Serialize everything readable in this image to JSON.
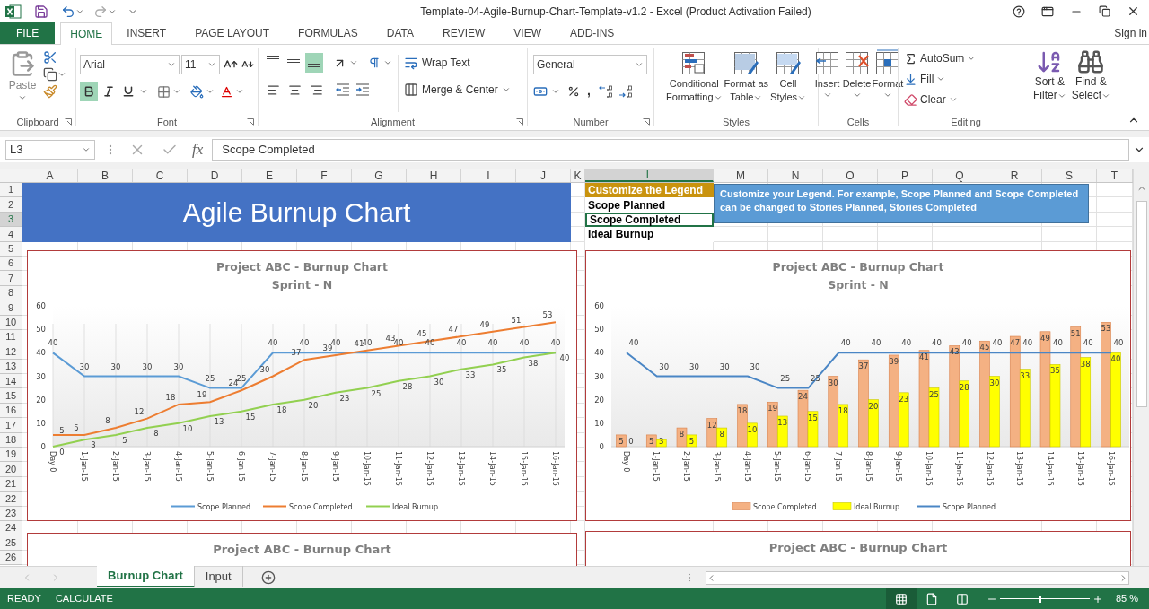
{
  "title_bar": {
    "title": "Template-04-Agile-Burnup-Chart-Template-v1.2 - Excel (Product Activation Failed)"
  },
  "ribbon_tabs": [
    {
      "label": "FILE",
      "kind": "file",
      "selected": false
    },
    {
      "label": "HOME",
      "kind": "tab",
      "selected": true
    },
    {
      "label": "INSERT",
      "kind": "tab",
      "selected": false
    },
    {
      "label": "PAGE LAYOUT",
      "kind": "tab",
      "selected": false
    },
    {
      "label": "FORMULAS",
      "kind": "tab",
      "selected": false
    },
    {
      "label": "DATA",
      "kind": "tab",
      "selected": false
    },
    {
      "label": "REVIEW",
      "kind": "tab",
      "selected": false
    },
    {
      "label": "VIEW",
      "kind": "tab",
      "selected": false
    },
    {
      "label": "ADD-INS",
      "kind": "tab",
      "selected": false
    }
  ],
  "sign_in": "Sign in",
  "ribbon": {
    "clipboard": {
      "label": "Clipboard",
      "paste": "Paste"
    },
    "font": {
      "label": "Font",
      "font_name": "Arial",
      "font_size": "11",
      "toggles": [
        {
          "kind": "bold",
          "selected": true
        },
        {
          "kind": "italic",
          "selected": false
        },
        {
          "kind": "underline",
          "selected": false
        }
      ]
    },
    "alignment": {
      "label": "Alignment",
      "vertical": [
        {
          "kind": "top",
          "selected": false
        },
        {
          "kind": "middle",
          "selected": false
        },
        {
          "kind": "bottom",
          "selected": true
        }
      ],
      "horizontal": [
        {
          "kind": "left",
          "selected": false
        },
        {
          "kind": "center",
          "selected": false
        },
        {
          "kind": "right",
          "selected": false
        }
      ],
      "wrap_text": "Wrap Text",
      "merge_center": "Merge & Center"
    },
    "number": {
      "label": "Number",
      "format": "General",
      "comma": ","
    },
    "styles": {
      "label": "Styles",
      "buttons": [
        {
          "kind": "conditional",
          "line1": "Conditional",
          "line2": "Formatting"
        },
        {
          "kind": "table",
          "line1": "Format as",
          "line2": "Table"
        },
        {
          "kind": "cell_styles",
          "line1": "Cell",
          "line2": "Styles"
        }
      ]
    },
    "cells": {
      "label": "Cells",
      "buttons": [
        {
          "kind": "insert",
          "label": "Insert"
        },
        {
          "kind": "delete",
          "label": "Delete"
        },
        {
          "kind": "format",
          "label": "Format"
        }
      ]
    },
    "editing": {
      "label": "Editing",
      "autosum": "AutoSum",
      "fill": "Fill",
      "clear": "Clear",
      "sort": [
        "Sort &",
        "Filter"
      ],
      "find": [
        "Find &",
        "Select"
      ]
    }
  },
  "formula_bar": {
    "name_box": "L3",
    "fx": "fx",
    "value": "Scope Completed"
  },
  "sheet": {
    "columns": [
      {
        "label": "A",
        "selected": false
      },
      {
        "label": "B",
        "selected": false
      },
      {
        "label": "C",
        "selected": false
      },
      {
        "label": "D",
        "selected": false
      },
      {
        "label": "E",
        "selected": false
      },
      {
        "label": "F",
        "selected": false
      },
      {
        "label": "G",
        "selected": false
      },
      {
        "label": "H",
        "selected": false
      },
      {
        "label": "I",
        "selected": false
      },
      {
        "label": "J",
        "selected": false
      },
      {
        "label": "K",
        "selected": false
      },
      {
        "label": "L",
        "selected": true
      },
      {
        "label": "M",
        "selected": false
      },
      {
        "label": "N",
        "selected": false
      },
      {
        "label": "O",
        "selected": false
      },
      {
        "label": "P",
        "selected": false
      },
      {
        "label": "Q",
        "selected": false
      },
      {
        "label": "R",
        "selected": false
      },
      {
        "label": "S",
        "selected": false
      },
      {
        "label": "T",
        "selected": false
      }
    ],
    "rows": [
      {
        "label": "1",
        "selected": false
      },
      {
        "label": "2",
        "selected": false
      },
      {
        "label": "3",
        "selected": true
      },
      {
        "label": "4",
        "selected": false
      },
      {
        "label": "5",
        "selected": false
      },
      {
        "label": "6",
        "selected": false
      },
      {
        "label": "7",
        "selected": false
      },
      {
        "label": "8",
        "selected": false
      },
      {
        "label": "9",
        "selected": false
      },
      {
        "label": "10",
        "selected": false
      },
      {
        "label": "11",
        "selected": false
      },
      {
        "label": "12",
        "selected": false
      },
      {
        "label": "13",
        "selected": false
      },
      {
        "label": "14",
        "selected": false
      },
      {
        "label": "15",
        "selected": false
      },
      {
        "label": "16",
        "selected": false
      },
      {
        "label": "17",
        "selected": false
      },
      {
        "label": "18",
        "selected": false
      },
      {
        "label": "19",
        "selected": false
      },
      {
        "label": "20",
        "selected": false
      },
      {
        "label": "21",
        "selected": false
      },
      {
        "label": "22",
        "selected": false
      },
      {
        "label": "23",
        "selected": false
      },
      {
        "label": "24",
        "selected": false
      },
      {
        "label": "25",
        "selected": false
      },
      {
        "label": "26",
        "selected": false
      }
    ],
    "banner": "Agile Burnup Chart",
    "legend_cells": [
      {
        "text": "Customize the Legend",
        "kind": "header",
        "selected": false
      },
      {
        "text": "Scope Planned",
        "kind": "plain",
        "selected": false
      },
      {
        "text": "Scope Completed",
        "kind": "plain",
        "selected": true
      },
      {
        "text": "Ideal Burnup",
        "kind": "plain",
        "selected": false
      }
    ],
    "note": "Customize your Legend. For example,  Scope Planned and Scope Completed can be changed to Stories Planned, Stories Completed",
    "charts": [
      {
        "title": "Project ABC - Burnup Chart",
        "subtitle": "Sprint - N",
        "chart_data": {
          "type": "line",
          "categories": [
            "Day 0",
            "1-Jan-15",
            "2-Jan-15",
            "3-Jan-15",
            "4-Jan-15",
            "5-Jan-15",
            "6-Jan-15",
            "7-Jan-15",
            "8-Jan-15",
            "9-Jan-15",
            "10-Jan-15",
            "11-Jan-15",
            "12-Jan-15",
            "13-Jan-15",
            "14-Jan-15",
            "15-Jan-15",
            "16-Jan-15"
          ],
          "ylim": [
            0,
            60
          ],
          "yticks": [
            0,
            10,
            20,
            30,
            40,
            50,
            60
          ],
          "data_labels": true,
          "series": [
            {
              "name": "Scope Planned",
              "color": "#5b9bd5",
              "type": "line",
              "values": [
                40,
                30,
                30,
                30,
                30,
                25,
                25,
                40,
                40,
                40,
                40,
                40,
                40,
                40,
                40,
                40,
                40
              ]
            },
            {
              "name": "Scope Completed",
              "color": "#ed7d31",
              "type": "line",
              "values": [
                5,
                5,
                8,
                12,
                18,
                19,
                24,
                30,
                37,
                39,
                41,
                43,
                45,
                47,
                49,
                51,
                53
              ]
            },
            {
              "name": "Ideal Burnup",
              "color": "#92d050",
              "type": "line",
              "values": [
                0,
                3,
                5,
                8,
                10,
                13,
                15,
                18,
                20,
                23,
                25,
                28,
                30,
                33,
                35,
                38,
                40
              ]
            }
          ],
          "grid": true,
          "legend": "bottom"
        }
      },
      {
        "title": "Project ABC - Burnup Chart",
        "subtitle": "Sprint - N",
        "chart_data": {
          "type": "bar",
          "categories": [
            "Day 0",
            "1-Jan-15",
            "2-Jan-15",
            "3-Jan-15",
            "4-Jan-15",
            "5-Jan-15",
            "6-Jan-15",
            "7-Jan-15",
            "8-Jan-15",
            "9-Jan-15",
            "10-Jan-15",
            "11-Jan-15",
            "12-Jan-15",
            "13-Jan-15",
            "14-Jan-15",
            "15-Jan-15",
            "16-Jan-15"
          ],
          "ylim": [
            0,
            60
          ],
          "yticks": [
            0,
            10,
            20,
            30,
            40,
            50,
            60
          ],
          "data_labels": true,
          "series": [
            {
              "name": "Scope Completed",
              "color": "#f4b183",
              "type": "bar",
              "values": [
                5,
                5,
                8,
                12,
                18,
                19,
                24,
                30,
                37,
                39,
                41,
                43,
                45,
                47,
                49,
                51,
                53
              ]
            },
            {
              "name": "Ideal Burnup",
              "color": "#ffff00",
              "type": "bar",
              "values": [
                0,
                3,
                5,
                8,
                10,
                13,
                15,
                18,
                20,
                23,
                25,
                28,
                30,
                33,
                35,
                38,
                40
              ]
            },
            {
              "name": "Scope Planned",
              "color": "#4a86c5",
              "type": "line",
              "values": [
                40,
                30,
                30,
                30,
                30,
                25,
                25,
                40,
                40,
                40,
                40,
                40,
                40,
                40,
                40,
                40,
                40
              ]
            }
          ],
          "legend": "bottom"
        }
      }
    ],
    "more_charts": [
      {
        "title": "Project ABC - Burnup Chart"
      },
      {
        "title": "Project ABC - Burnup Chart"
      }
    ]
  },
  "sheet_tabs": [
    {
      "label": "Burnup Chart",
      "selected": true
    },
    {
      "label": "Input",
      "selected": false
    }
  ],
  "status_bar": {
    "mode": "READY",
    "calculate": "CALCULATE",
    "views": [
      {
        "kind": "normal",
        "selected": true
      },
      {
        "kind": "page_layout",
        "selected": false
      },
      {
        "kind": "page_break",
        "selected": false
      }
    ],
    "zoom": {
      "level": 0.45,
      "label": "85 %"
    }
  }
}
